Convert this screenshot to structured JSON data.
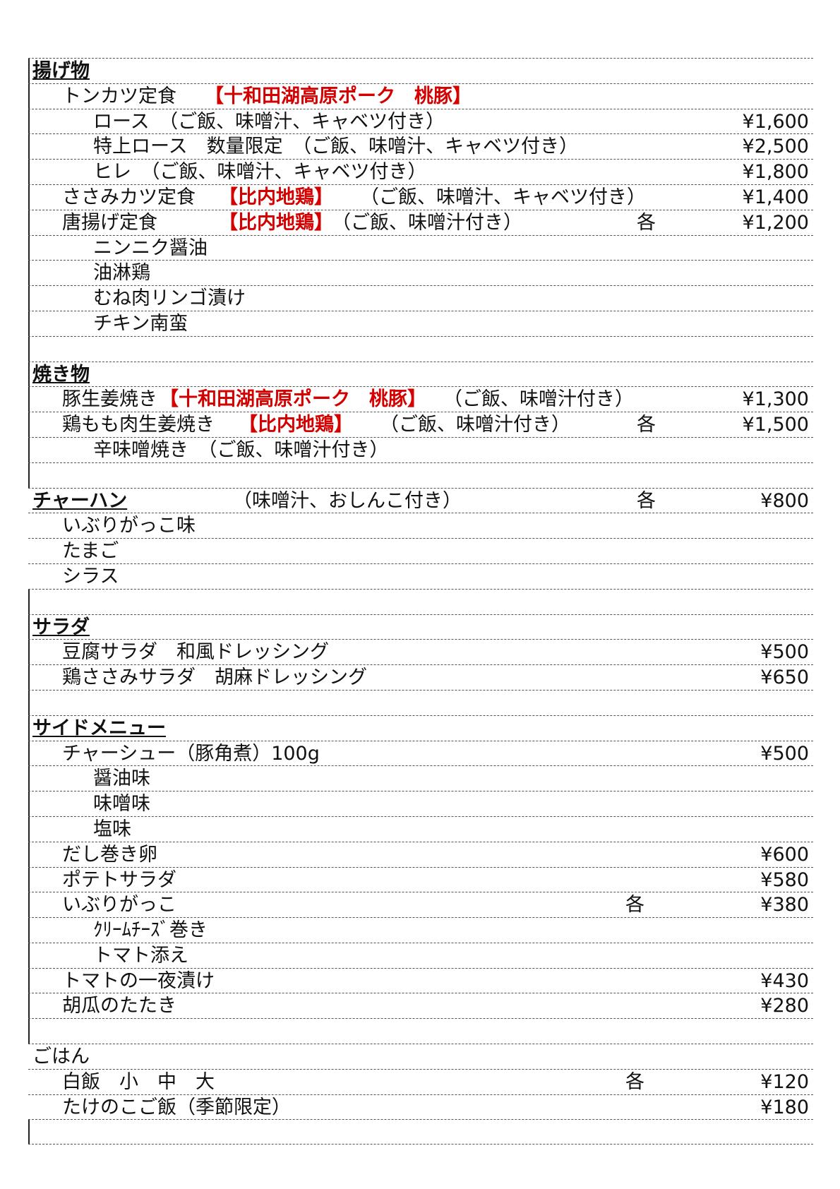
{
  "sections": {
    "agemono": {
      "heading": "揚げ物",
      "tonkatsu": {
        "label": "トンカツ定食",
        "brand": "【十和田湖高原ポーク　桃豚】"
      },
      "rosu": {
        "label": "ロース　（ご飯、味噌汁、キャベツ付き）",
        "price": "¥1,600"
      },
      "tokujo": {
        "label": "特上ロース　数量限定　（ご飯、味噌汁、キャベツ付き）",
        "price": "¥2,500"
      },
      "hire": {
        "label": "ヒレ　（ご飯、味噌汁、キャベツ付き）",
        "price": "¥1,800"
      },
      "sasami": {
        "label": "ささみカツ定食",
        "brand": "【比内地鶏】",
        "note": "（ご飯、味噌汁、キャベツ付き）",
        "price": "¥1,400"
      },
      "karaage": {
        "label": "唐揚げ定食",
        "brand": "【比内地鶏】",
        "note": "（ご飯、味噌汁付き）",
        "each": "各",
        "price": "¥1,200"
      },
      "options": [
        "ニンニク醤油",
        "油淋鶏",
        "むね肉リンゴ漬け",
        "チキン南蛮"
      ]
    },
    "yakimono": {
      "heading": "焼き物",
      "buta": {
        "label": "豚生姜焼き",
        "brand": "【十和田湖高原ポーク　桃豚】",
        "note": "（ご飯、味噌汁付き）",
        "price": "¥1,300"
      },
      "tori": {
        "label": "鶏もも肉生姜焼き",
        "brand": "【比内地鶏】",
        "note": "（ご飯、味噌汁付き）",
        "each": "各",
        "price": "¥1,500"
      },
      "karamiso": {
        "label": "辛味噌焼き　（ご飯、味噌汁付き）"
      }
    },
    "chahan": {
      "heading": "チャーハン",
      "note": "（味噌汁、おしんこ付き）",
      "each": "各",
      "price": "¥800",
      "options": [
        "いぶりがっこ味",
        "たまご",
        "シラス"
      ]
    },
    "salad": {
      "heading": "サラダ",
      "tofu": {
        "label": "豆腐サラダ　和風ドレッシング",
        "price": "¥500"
      },
      "sasami": {
        "label": "鶏ささみサラダ　胡麻ドレッシング",
        "price": "¥650"
      }
    },
    "side": {
      "heading": "サイドメニュー",
      "chashu": {
        "label": "チャーシュー（豚角煮）100g",
        "price": "¥500"
      },
      "chashu_options": [
        "醤油味",
        "味噌味",
        "塩味"
      ],
      "dashimaki": {
        "label": "だし巻き卵",
        "price": "¥600"
      },
      "potato": {
        "label": "ポテトサラダ",
        "price": "¥580"
      },
      "iburi": {
        "label": "いぶりがっこ",
        "each": "各",
        "price": "¥380"
      },
      "iburi_options": [
        "ｸﾘｰﾑﾁｰｽﾞ巻き",
        "トマト添え"
      ],
      "tomato": {
        "label": "トマトの一夜漬け",
        "price": "¥430"
      },
      "kyuri": {
        "label": "胡瓜のたたき",
        "price": "¥280"
      }
    },
    "gohan": {
      "heading": "ごはん",
      "hakumai": {
        "label": "白飯　小　中　大",
        "each": "各",
        "price": "¥120"
      },
      "takenoko": {
        "label": "たけのこご飯（季節限定）",
        "price": "¥180"
      }
    }
  }
}
